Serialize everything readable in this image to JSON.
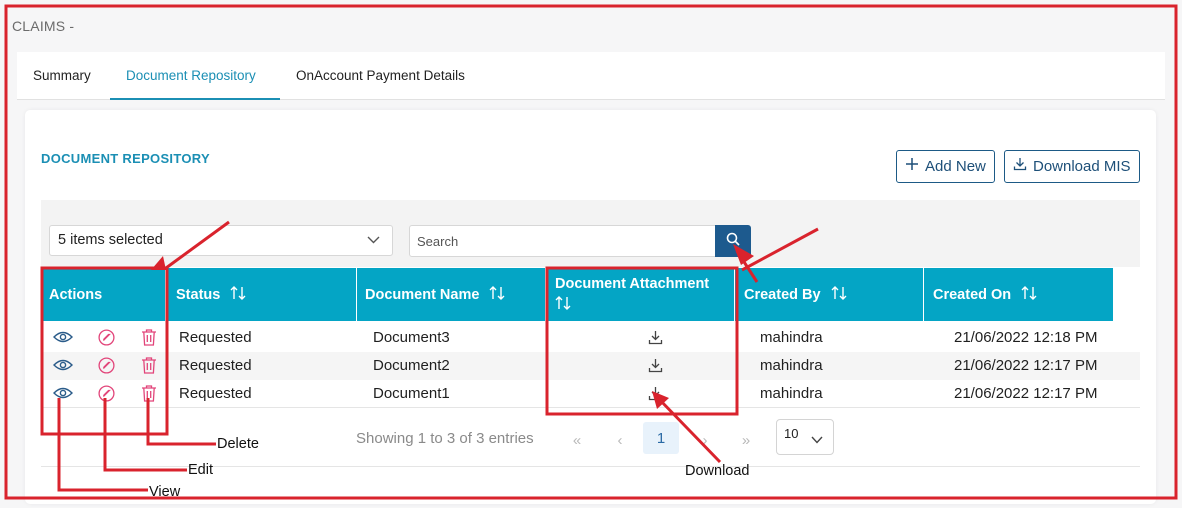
{
  "breadcrumb": "CLAIMS -",
  "tabs": [
    {
      "label": "Summary",
      "active": false
    },
    {
      "label": "Document Repository",
      "active": true
    },
    {
      "label": "OnAccount Payment Details",
      "active": false
    }
  ],
  "section_title": "DOCUMENT REPOSITORY",
  "buttons": {
    "add_new": "Add New",
    "download_mis": "Download MIS"
  },
  "filters": {
    "multiselect_value": "5 items selected",
    "search_placeholder": "Search"
  },
  "table": {
    "columns": [
      "Actions",
      "Status",
      "Document Name",
      "Document Attachment",
      "Created By",
      "Created On"
    ],
    "rows": [
      {
        "status": "Requested",
        "document_name": "Document3",
        "created_by": "mahindra",
        "created_on": "21/06/2022 12:18 PM"
      },
      {
        "status": "Requested",
        "document_name": "Document2",
        "created_by": "mahindra",
        "created_on": "21/06/2022 12:17 PM"
      },
      {
        "status": "Requested",
        "document_name": "Document1",
        "created_by": "mahindra",
        "created_on": "21/06/2022 12:17 PM"
      }
    ]
  },
  "pagination": {
    "summary": "Showing 1 to 3 of 3 entries",
    "first": "«",
    "prev": "‹",
    "current": "1",
    "next": "›",
    "last": "»",
    "page_size": "10"
  },
  "annotations": {
    "delete": "Delete",
    "edit": "Edit",
    "view": "View",
    "download": "Download"
  },
  "colors": {
    "accent": "#1b8fb4",
    "header_bg": "#04a5c5",
    "primary_btn": "#1d5a8e",
    "action_view": "#2b5c8a",
    "action_edit_delete": "#e2457a",
    "annotation_red": "#d9232d"
  }
}
